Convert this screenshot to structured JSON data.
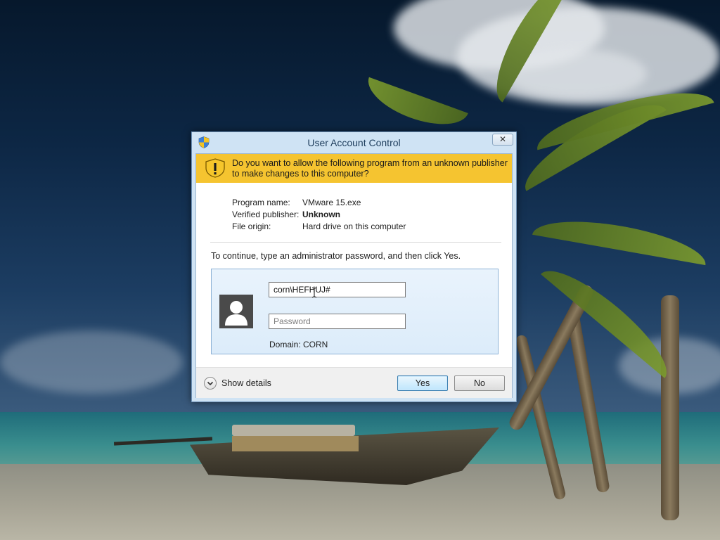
{
  "dialog": {
    "title": "User Account Control",
    "close_glyph": "✕",
    "banner_text": "Do you want to allow the following program from an unknown publisher to make changes to this computer?",
    "details": [
      {
        "label": "Program name:",
        "value": "VMware 15.exe",
        "bold": false
      },
      {
        "label": "Verified publisher:",
        "value": "Unknown",
        "bold": true
      },
      {
        "label": "File origin:",
        "value": "Hard drive on this computer",
        "bold": false
      }
    ],
    "instruction": "To continue, type an administrator password, and then click Yes.",
    "credentials": {
      "username_value": "corn\\HEFHUJ#",
      "password_placeholder": "Password",
      "domain_text": "Domain: CORN"
    },
    "show_details_label": "Show details",
    "yes_label": "Yes",
    "no_label": "No"
  },
  "colors": {
    "banner": "#f5c430",
    "dialog_frame": "#cfe3f4",
    "tile": "#dcecfa"
  },
  "icons": {
    "title": "uac-shield-icon",
    "banner": "warning-shield-icon",
    "avatar": "user-avatar-icon",
    "details": "chevron-down-icon",
    "cursor": "text-cursor-icon"
  }
}
